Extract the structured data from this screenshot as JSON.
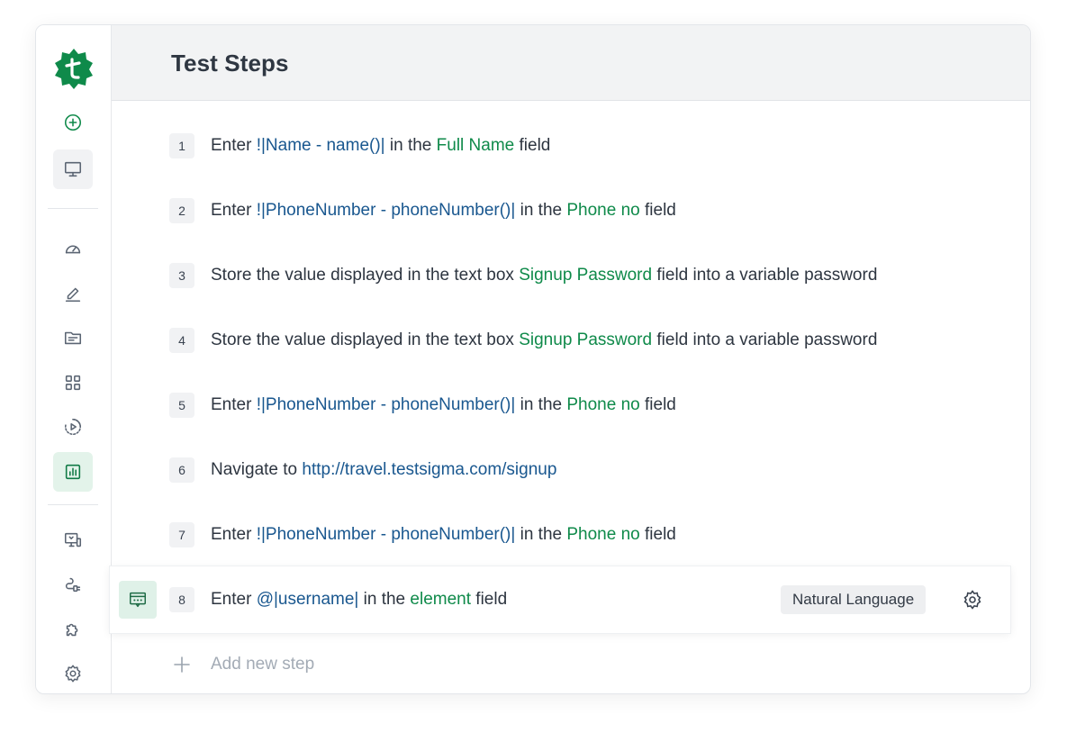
{
  "header": {
    "title": "Test Steps"
  },
  "colors": {
    "brand_green": "#0f8a4a",
    "keyword_blue": "#19578f",
    "active_bg": "#e3f3ea"
  },
  "sidebar": {
    "logo": "testsigma-logo",
    "items": [
      {
        "icon": "plus-circle-icon"
      },
      {
        "icon": "monitor-icon"
      },
      {
        "icon": "dashboard-gauge-icon"
      },
      {
        "icon": "edit-pen-icon"
      },
      {
        "icon": "folder-icon"
      },
      {
        "icon": "grid-icon"
      },
      {
        "icon": "play-circle-icon"
      },
      {
        "icon": "bar-chart-icon",
        "active": true
      },
      {
        "icon": "device-monitor-icon"
      },
      {
        "icon": "plug-icon"
      },
      {
        "icon": "puzzle-icon"
      },
      {
        "icon": "gear-icon"
      }
    ]
  },
  "steps": [
    {
      "num": "1",
      "parts": [
        {
          "t": "Enter "
        },
        {
          "t": "!|Name - name()|",
          "c": "blue"
        },
        {
          "t": " in the "
        },
        {
          "t": "Full Name",
          "c": "green"
        },
        {
          "t": " field"
        }
      ]
    },
    {
      "num": "2",
      "parts": [
        {
          "t": "Enter "
        },
        {
          "t": "!|PhoneNumber - phoneNumber()|",
          "c": "blue"
        },
        {
          "t": " in the "
        },
        {
          "t": "Phone no",
          "c": "green"
        },
        {
          "t": " field"
        }
      ]
    },
    {
      "num": "3",
      "parts": [
        {
          "t": "Store the value displayed in the text box "
        },
        {
          "t": "Signup Password",
          "c": "green"
        },
        {
          "t": " field into a variable password"
        }
      ]
    },
    {
      "num": "4",
      "parts": [
        {
          "t": "Store the value displayed in the text box "
        },
        {
          "t": "Signup Password",
          "c": "green"
        },
        {
          "t": " field into a variable password"
        }
      ]
    },
    {
      "num": "5",
      "parts": [
        {
          "t": "Enter "
        },
        {
          "t": "!|PhoneNumber - phoneNumber()|",
          "c": "blue"
        },
        {
          "t": " in the "
        },
        {
          "t": "Phone no",
          "c": "green"
        },
        {
          "t": " field"
        }
      ]
    },
    {
      "num": "6",
      "parts": [
        {
          "t": "Navigate to "
        },
        {
          "t": "http://travel.testsigma.com/signup",
          "c": "blue"
        }
      ]
    },
    {
      "num": "7",
      "parts": [
        {
          "t": "Enter "
        },
        {
          "t": "!|PhoneNumber - phoneNumber()|",
          "c": "blue"
        },
        {
          "t": " in the "
        },
        {
          "t": "Phone no",
          "c": "green"
        },
        {
          "t": " field"
        }
      ]
    },
    {
      "num": "8",
      "selected": true,
      "badge": "Natural Language",
      "parts": [
        {
          "t": "Enter "
        },
        {
          "t": "@|username|",
          "c": "blue"
        },
        {
          "t": " in the "
        },
        {
          "t": "element",
          "c": "green"
        },
        {
          "t": " field"
        }
      ]
    }
  ],
  "add_step": {
    "label": "Add new step"
  }
}
